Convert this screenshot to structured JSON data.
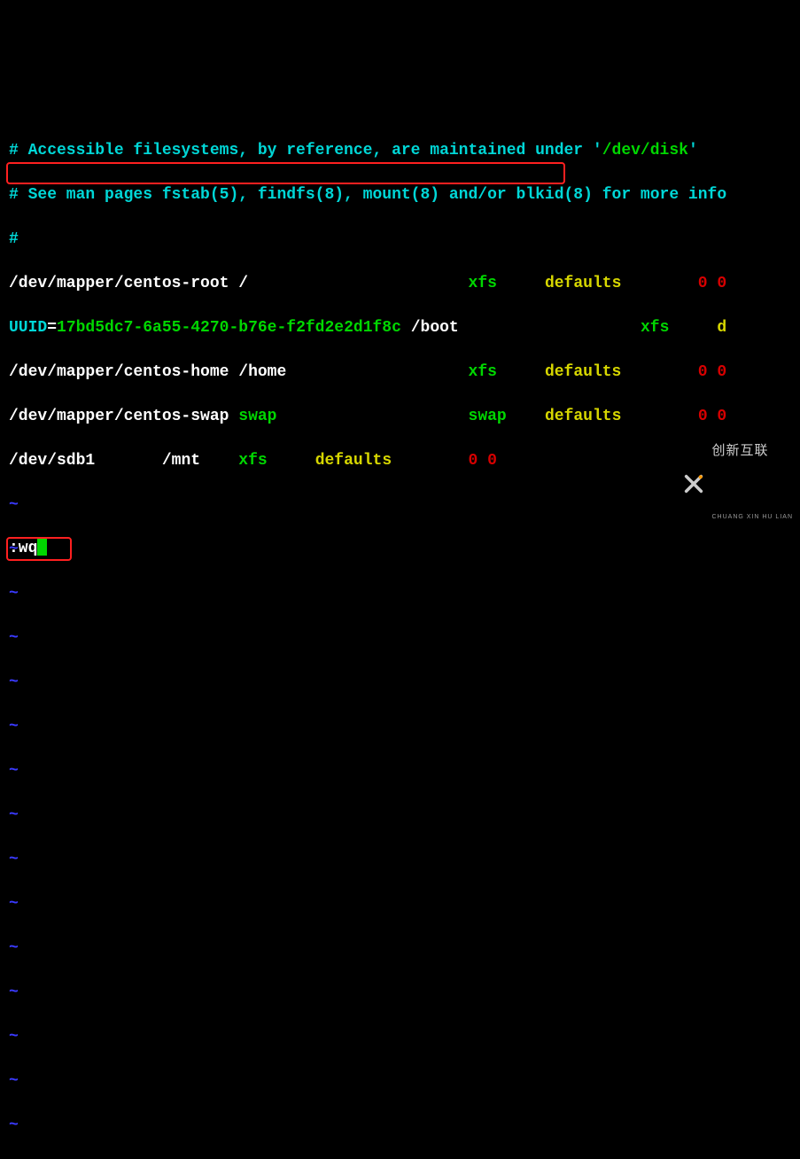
{
  "comments": {
    "line1_a": "# Accessible filesystems, by reference, are maintained under '",
    "line1_b": "/dev/disk",
    "line1_c": "'",
    "line2": "# See man pages fstab(5), findfs(8), mount(8) and/or blkid(8) for more info",
    "line3": "#"
  },
  "fstab": {
    "row1": {
      "dev": "/dev/mapper/centos-root",
      "sp1": " ",
      "mnt": "/",
      "sp2": "                       ",
      "fs": "xfs",
      "sp3": "     ",
      "opt": "defaults",
      "sp4": "        ",
      "dump": "0 0"
    },
    "row2": {
      "key": "UUID",
      "eq": "=",
      "uuid": "17bd5dc7-6a55-4270-b76e-f2fd2e2d1f8c",
      "sp1": " ",
      "mnt": "/boot",
      "sp2": "                   ",
      "fs": "xfs",
      "sp3": "     ",
      "opt": "d"
    },
    "row3": {
      "dev": "/dev/mapper/centos-home",
      "sp1": " ",
      "mnt": "/home",
      "sp2": "                   ",
      "fs": "xfs",
      "sp3": "     ",
      "opt": "defaults",
      "sp4": "        ",
      "dump": "0 0"
    },
    "row4": {
      "dev": "/dev/mapper/centos-swap",
      "sp1": " ",
      "mnt": "swap",
      "sp2": "                    ",
      "fs": "swap",
      "sp3": "    ",
      "opt": "defaults",
      "sp4": "        ",
      "dump": "0 0"
    },
    "row5": {
      "dev": "/dev/sdb1",
      "sp1": "       ",
      "mnt": "/mnt",
      "sp2": "    ",
      "fs": "xfs",
      "sp3": "     ",
      "opt": "defaults",
      "sp4": "        ",
      "dump": "0 0"
    }
  },
  "tilde": "~",
  "cmd": ":wq",
  "watermark": {
    "chinese": "创新互联",
    "pinyin": "CHUANG XIN HU LIAN"
  }
}
